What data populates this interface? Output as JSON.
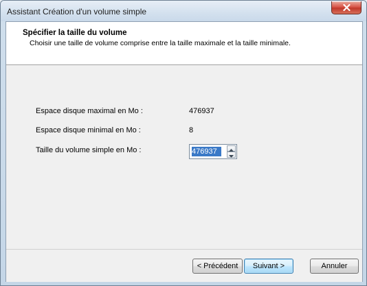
{
  "window": {
    "title": "Assistant Création d'un volume simple"
  },
  "header": {
    "title": "Spécifier la taille du volume",
    "subtitle": "Choisir une taille de volume comprise entre la taille maximale et la taille minimale."
  },
  "fields": {
    "max_label": "Espace disque maximal en Mo :",
    "max_value": "476937",
    "min_label": "Espace disque minimal en Mo :",
    "min_value": "8",
    "size_label": "Taille du volume simple en Mo :",
    "size_value": "476937"
  },
  "buttons": {
    "previous": "< Précédent",
    "next": "Suivant >",
    "cancel": "Annuler"
  },
  "icons": {
    "close": "close-icon",
    "spin_up": "chevron-up-icon",
    "spin_down": "chevron-down-icon"
  },
  "colors": {
    "selection": "#3a79c7",
    "close_button": "#c0392b",
    "default_button_border": "#3c7fb1"
  }
}
